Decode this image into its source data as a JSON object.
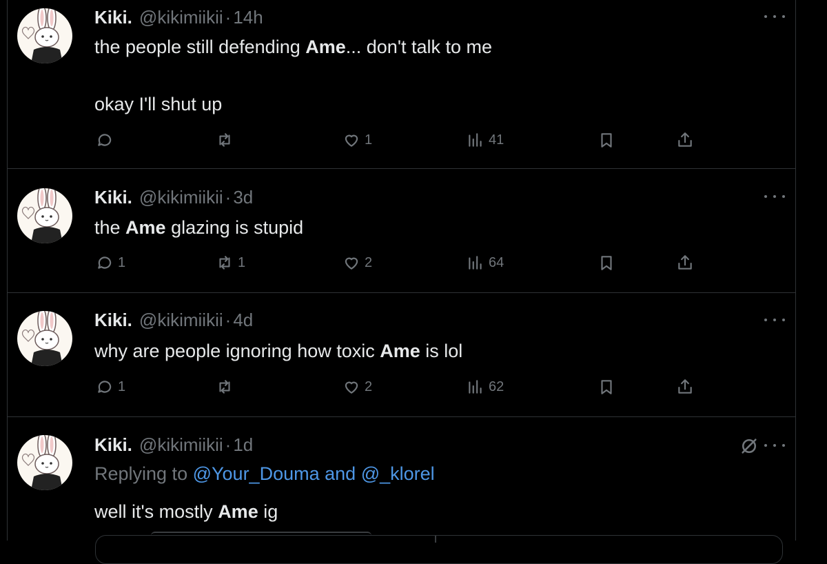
{
  "colors": {
    "background": "#000000",
    "text": "#e7e9ea",
    "muted": "#71767b",
    "link": "#4e97e6",
    "border": "#2f3336"
  },
  "icons": {
    "reply": "speech-bubble-icon",
    "repost": "repost-arrows-icon",
    "like": "heart-icon",
    "views": "bar-chart-icon",
    "bookmark": "bookmark-icon",
    "share": "share-upload-icon",
    "more": "three-dots-icon",
    "muted": "mute-circle-slash-icon"
  },
  "tweets": [
    {
      "name": "Kiki.",
      "handle": "@kikimiikii",
      "sep": "·",
      "time": "14h",
      "line1": {
        "before": "the people still defending ",
        "bold": "Ame",
        "after": "... don't talk to me"
      },
      "line2": "okay I'll shut up",
      "reply_count": "",
      "repost_count": "",
      "like_count": "1",
      "view_count": "41"
    },
    {
      "name": "Kiki.",
      "handle": "@kikimiikii",
      "sep": "·",
      "time": "3d",
      "line1": {
        "before": "the ",
        "bold": "Ame",
        "after": " glazing is stupid"
      },
      "reply_count": "1",
      "repost_count": "1",
      "like_count": "2",
      "view_count": "64"
    },
    {
      "name": "Kiki.",
      "handle": "@kikimiikii",
      "sep": "·",
      "time": "4d",
      "line1": {
        "before": "why are people ignoring how toxic ",
        "bold": "Ame",
        "after": " is lol"
      },
      "reply_count": "1",
      "repost_count": "",
      "like_count": "2",
      "view_count": "62"
    },
    {
      "name": "Kiki.",
      "handle": "@kikimiikii",
      "sep": "·",
      "time": "1d",
      "replying_prefix": "Replying to ",
      "mention1": "@Your_Douma",
      "mention_join": " and ",
      "mention2": "@_klorel",
      "line1": {
        "before": "well it's mostly ",
        "bold": "Ame",
        "after": " ig"
      }
    }
  ]
}
